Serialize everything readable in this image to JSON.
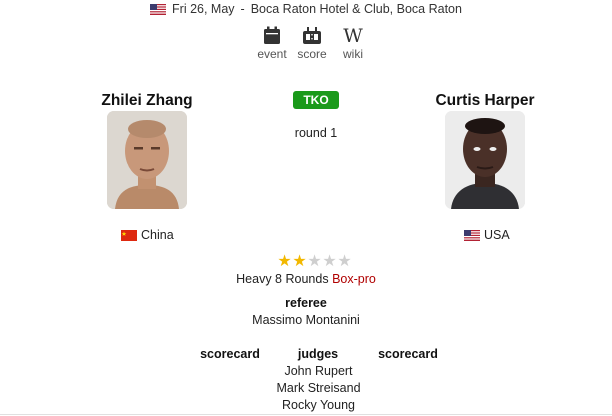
{
  "event": {
    "date": "Fri 26, May",
    "separator": "-",
    "venue": "Boca Raton Hotel & Club, Boca Raton"
  },
  "links": [
    {
      "label": "event",
      "icon": "calendar-icon"
    },
    {
      "label": "score",
      "icon": "scoreboard-icon"
    },
    {
      "label": "wiki",
      "icon": "wikipedia-icon"
    }
  ],
  "fighters": {
    "left": {
      "name": "Zhilei Zhang",
      "country": "China",
      "flag": "china-flag-icon"
    },
    "right": {
      "name": "Curtis Harper",
      "country": "USA",
      "flag": "usa-flag-icon"
    }
  },
  "result": {
    "method": "TKO",
    "round": "round 1",
    "badge_color": "#1a9a1a"
  },
  "rating": {
    "stars": 2,
    "max": 5
  },
  "bout": {
    "description": "Heavy 8 Rounds",
    "type_link": "Box-pro",
    "type_color": "#b00000"
  },
  "officials": {
    "referee_label": "referee",
    "referee": "Massimo Montanini",
    "scorecard_left": "scorecard",
    "judges_label": "judges",
    "scorecard_right": "scorecard",
    "judges": [
      "John Rupert",
      "Mark Streisand",
      "Rocky Young"
    ]
  }
}
